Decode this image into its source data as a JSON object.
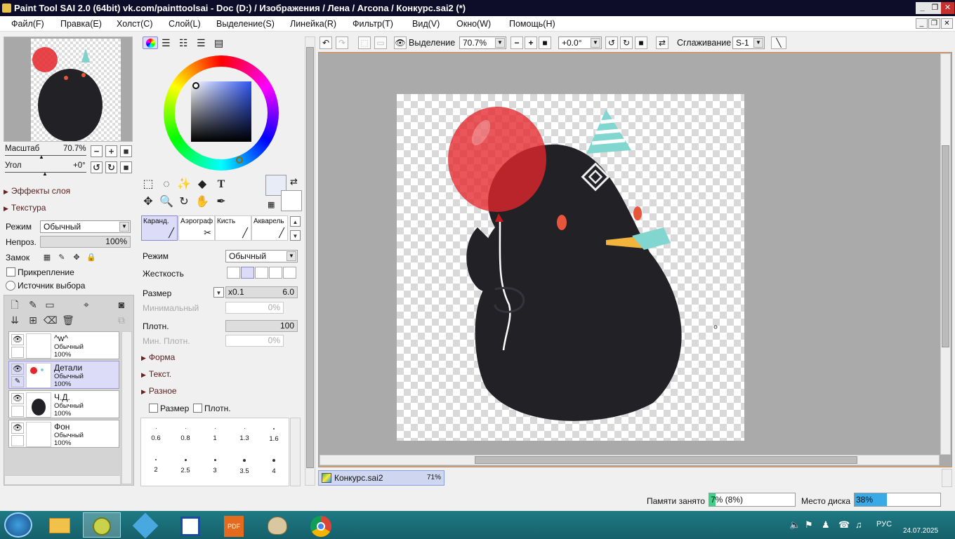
{
  "window": {
    "title": "Paint Tool SAI 2.0 (64bit) vk.com/painttoolsai - Doc (D:) / Изображения / Лена / Arcona / Конкурс.sai2 (*)"
  },
  "menu": [
    "Файл(F)",
    "Правка(E)",
    "Холст(C)",
    "Слой(L)",
    "Выделение(S)",
    "Линейка(R)",
    "Фильтр(T)",
    "Вид(V)",
    "Окно(W)",
    "Помощь(H)"
  ],
  "navigator": {
    "zoom_label": "Масштаб",
    "zoom_value": "70.7%",
    "angle_label": "Угол",
    "angle_value": "+0°"
  },
  "layer_props": {
    "effects": "Эффекты слоя",
    "texture": "Текстура",
    "mode_label": "Режим",
    "mode_value": "Обычный",
    "opacity_label": "Непроз.",
    "opacity_value": "100%",
    "lock_label": "Замок",
    "clip_label": "Прикрепление",
    "source_label": "Источник выбора"
  },
  "layers": [
    {
      "name": "^w^",
      "mode": "Обычный",
      "opacity": "100%",
      "selected": false
    },
    {
      "name": "Детали",
      "mode": "Обычный",
      "opacity": "100%",
      "selected": true
    },
    {
      "name": "Ч.Д.",
      "mode": "Обычный",
      "opacity": "100%",
      "selected": false
    },
    {
      "name": "Фон",
      "mode": "Обычный",
      "opacity": "100%",
      "selected": false
    }
  ],
  "brush_tabs": [
    "Каранд.",
    "Аэрограф",
    "Кисть",
    "Акварель"
  ],
  "brush": {
    "mode_label": "Режим",
    "mode_value": "Обычный",
    "hardness_label": "Жесткость",
    "size_label": "Размер",
    "size_mult": "x0.1",
    "size_value": "6.0",
    "min_label": "Минимальный",
    "min_value": "0%",
    "density_label": "Плотн.",
    "density_value": "100",
    "min_density_label": "Мин. Плотн.",
    "min_density_value": "0%",
    "shape": "Форма",
    "texture": "Текст.",
    "misc": "Разное",
    "size_chk": "Размер",
    "density_chk": "Плотн."
  },
  "brush_sizes": [
    "0.6",
    "0.8",
    "1",
    "1.3",
    "1.6",
    "2",
    "2.5",
    "3",
    "3.5",
    "4"
  ],
  "toolbar": {
    "selection_label": "Выделение",
    "zoom": "70.7%",
    "angle": "+0.0°",
    "smoothing_label": "Сглаживание",
    "smoothing_value": "S-1"
  },
  "doc_tab": {
    "name": "Конкурс.sai2",
    "zoom": "71%"
  },
  "status": {
    "memory_label": "Памяти занято",
    "memory_value": "7% (8%)",
    "memory_fraction": 0.07,
    "disk_label": "Место диска",
    "disk_value": "38%",
    "disk_fraction": 0.38
  },
  "taskbar": {
    "lang": "РУС",
    "date": "24.07.2025"
  },
  "colors": {
    "accent_border": "#e08a3a",
    "selected_layer": "#dcdcf8",
    "mem_fill": "#3fd08a",
    "disk_fill": "#3aa9e8",
    "balloon": "#e4262c",
    "blob": "#222226"
  }
}
